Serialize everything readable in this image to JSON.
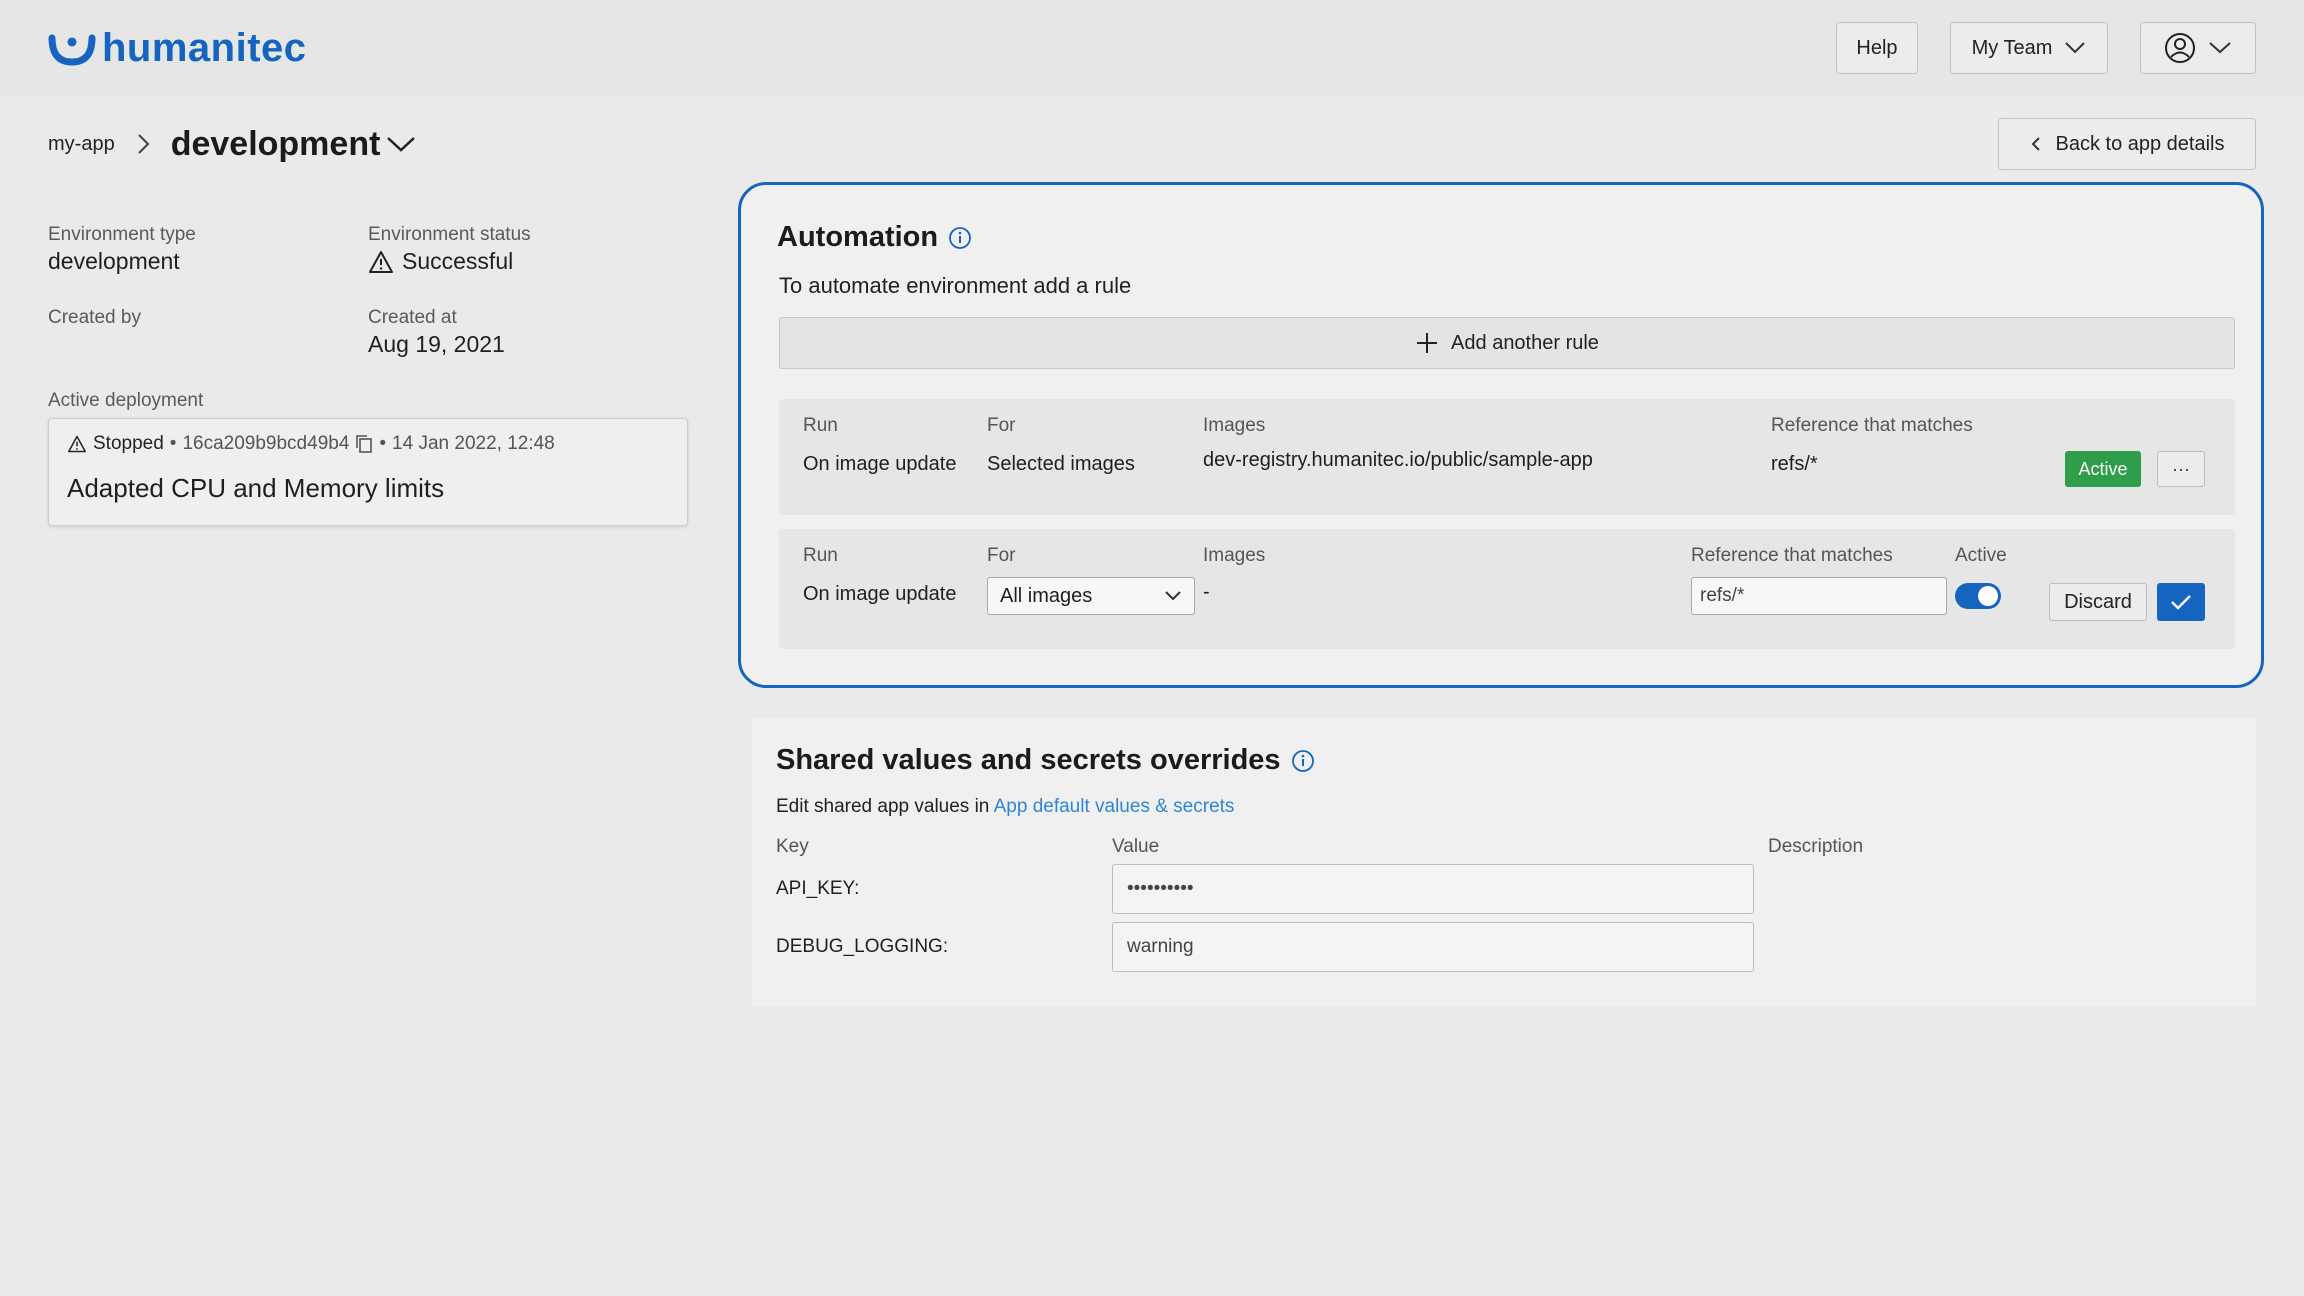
{
  "header": {
    "brand": "humanitec",
    "help_label": "Help",
    "team_label": "My Team",
    "brand_color": "#1565c0"
  },
  "breadcrumb": {
    "app": "my-app",
    "environment": "development",
    "back_label": "Back to app details"
  },
  "environment": {
    "type_label": "Environment type",
    "type_value": "development",
    "status_label": "Environment status",
    "status_value": "Successful",
    "created_by_label": "Created by",
    "created_at_label": "Created at",
    "created_at_value": "Aug 19, 2021",
    "active_deployment_label": "Active deployment"
  },
  "deployment": {
    "status": "Stopped",
    "sep1": "•",
    "hash": "16ca209b9bcd49b4",
    "sep2": "•",
    "date": "14 Jan 2022, 12:48",
    "title": "Adapted CPU and Memory limits"
  },
  "automation": {
    "title": "Automation",
    "subtitle": "To automate environment add a rule",
    "add_rule_label": "Add another rule",
    "rule1": {
      "run_label": "Run",
      "run_value": "On image update",
      "for_label": "For",
      "for_value": "Selected images",
      "images_label": "Images",
      "images_value": "dev-registry.humanitec.io/public/sample-app",
      "ref_label": "Reference that matches",
      "ref_value": "refs/*",
      "status": "Active",
      "more_label": "···"
    },
    "rule2": {
      "run_label": "Run",
      "run_value": "On image update",
      "for_label": "For",
      "for_selected": "All images",
      "images_label": "Images",
      "images_value": "-",
      "ref_label": "Reference that matches",
      "ref_value": "refs/*",
      "active_label": "Active",
      "active_on": true,
      "discard_label": "Discard"
    }
  },
  "shared": {
    "title": "Shared values and secrets overrides",
    "edit_prefix": "Edit shared app values in",
    "edit_link": "App default values & secrets",
    "key_header": "Key",
    "value_header": "Value",
    "description_header": "Description",
    "rows": [
      {
        "key": "API_KEY:",
        "value": "••••••••••"
      },
      {
        "key": "DEBUG_LOGGING:",
        "value": "warning"
      }
    ]
  }
}
